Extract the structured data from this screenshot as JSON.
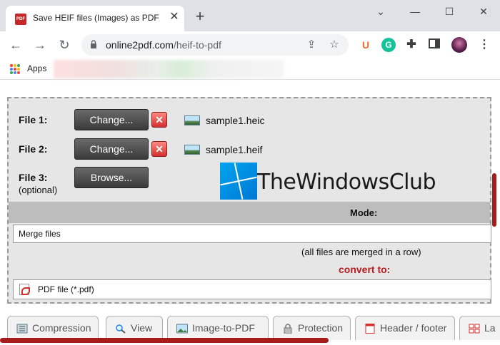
{
  "browser": {
    "tab_title": "Save HEIF files (Images) as PDF o",
    "favicon_text": "PDF",
    "url_host": "online2pdf.com",
    "url_path": "/heif-to-pdf",
    "bookmarks_apps_label": "Apps",
    "extension_u": "U",
    "extension_g": "G"
  },
  "form": {
    "file1_label": "File 1:",
    "file2_label": "File 2:",
    "file3_label": "File 3:",
    "file3_optional": "(optional)",
    "change_label": "Change...",
    "browse_label": "Browse...",
    "delete_glyph": "✕",
    "file1_name": "sample1.heic",
    "file2_name": "sample1.heif",
    "mode_label": "Mode:",
    "mode_value": "Merge files",
    "mode_note": "(all files are merged in a row)",
    "convert_label": "convert to:",
    "convert_value": "PDF file (*.pdf)"
  },
  "watermark": {
    "text": "TheWindowsClub"
  },
  "option_tabs": [
    {
      "label": "Compression"
    },
    {
      "label": "View"
    },
    {
      "label": "Image-to-PDF"
    },
    {
      "label": "Protection"
    },
    {
      "label": "Header / footer"
    },
    {
      "label": "La"
    }
  ],
  "colors": {
    "accent_red": "#b71c1c",
    "scrollbar": "#a61b1b",
    "logo_blue": "#0078d4"
  }
}
